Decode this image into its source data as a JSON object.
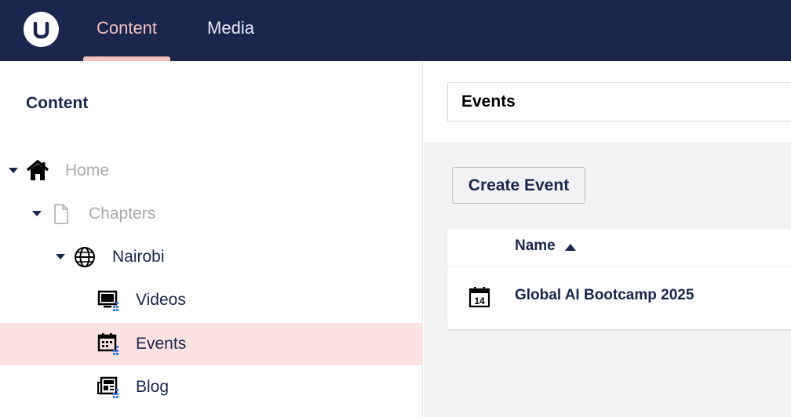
{
  "topbar": {
    "logo_icon": "umbraco-logo-icon",
    "sections": [
      {
        "label": "Content",
        "active": true
      },
      {
        "label": "Media",
        "active": false
      }
    ],
    "accent_color": "#f5c1bc",
    "background_color": "#1b264f"
  },
  "sidebar": {
    "title": "Content",
    "tree": [
      {
        "label": "Home",
        "icon": "home-icon",
        "expanded": true,
        "muted": true
      },
      {
        "label": "Chapters",
        "icon": "document-icon",
        "expanded": true,
        "muted": true
      },
      {
        "label": "Nairobi",
        "icon": "globe-icon",
        "expanded": true,
        "muted": false
      },
      {
        "label": "Videos",
        "icon": "video-list-icon",
        "expanded": false,
        "muted": false
      },
      {
        "label": "Events",
        "icon": "calendar-list-icon",
        "expanded": false,
        "muted": false,
        "active": true
      },
      {
        "label": "Blog",
        "icon": "newspaper-list-icon",
        "expanded": false,
        "muted": false
      }
    ]
  },
  "main": {
    "name_value": "Events",
    "create_button_label": "Create Event",
    "table": {
      "columns": [
        {
          "label": "Name",
          "sort": "ascending"
        }
      ],
      "rows": [
        {
          "name": "Global AI Bootcamp 2025",
          "icon": "calendar-day-14-icon",
          "icon_text": "14"
        }
      ]
    }
  }
}
